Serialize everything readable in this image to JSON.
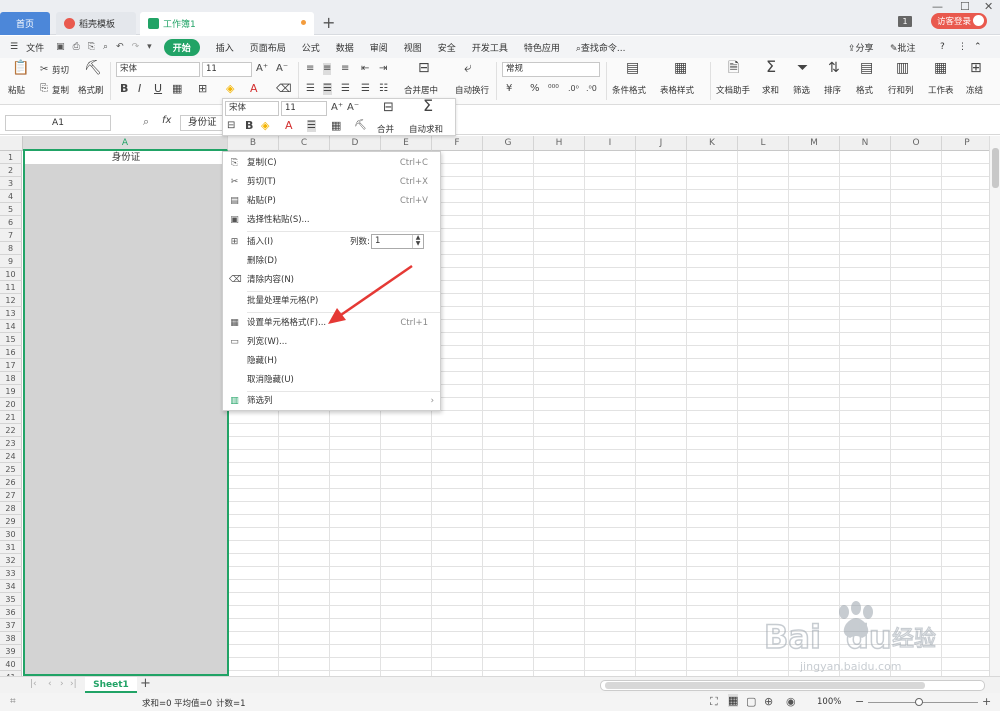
{
  "tabs": {
    "home": "首页",
    "template": "稻壳模板",
    "workbook": "工作簿1",
    "add": "+"
  },
  "topright": {
    "count_badge": "1",
    "guest_login": "访客登录"
  },
  "menu": {
    "file": "文件",
    "items": [
      "开始",
      "插入",
      "页面布局",
      "公式",
      "数据",
      "审阅",
      "视图",
      "安全",
      "开发工具",
      "特色应用"
    ],
    "search": "查找命令...",
    "share": "分享",
    "comment": "批注",
    "help": "?"
  },
  "ribbon": {
    "cut": "剪切",
    "paste": "粘贴",
    "copy": "复制",
    "format_painter": "格式刷",
    "font": "宋体",
    "size": "11",
    "merge_center": "合并居中",
    "wrap": "自动换行",
    "number_format": "常规",
    "cond_format": "条件格式",
    "table_style": "表格样式",
    "doc_helper": "文档助手",
    "sum": "求和",
    "filter": "筛选",
    "sort": "排序",
    "format": "格式",
    "rowcol": "行和列",
    "worksheet": "工作表",
    "freeze": "冻结"
  },
  "formula": {
    "namebox": "A1",
    "fx": "fx",
    "content": "身份证"
  },
  "mini_toolbar": {
    "font": "宋体",
    "size": "11",
    "merge": "合并",
    "autosum": "自动求和"
  },
  "grid": {
    "columns": [
      "A",
      "B",
      "C",
      "D",
      "E",
      "F",
      "G",
      "H",
      "I",
      "J",
      "K",
      "L",
      "M",
      "N",
      "O",
      "P"
    ],
    "rows": [
      "1",
      "2",
      "3",
      "4",
      "5",
      "6",
      "7",
      "8",
      "9",
      "10",
      "11",
      "12",
      "13",
      "14",
      "15",
      "16",
      "17",
      "18",
      "19",
      "20",
      "21",
      "22",
      "23",
      "24",
      "25",
      "26",
      "27",
      "28",
      "29",
      "30",
      "31",
      "32",
      "33",
      "34",
      "35",
      "36",
      "37",
      "38",
      "39",
      "40",
      "41"
    ],
    "a1": "身份证"
  },
  "context_menu": {
    "copy": "复制(C)",
    "copy_key": "Ctrl+C",
    "cut": "剪切(T)",
    "cut_key": "Ctrl+X",
    "paste": "粘贴(P)",
    "paste_key": "Ctrl+V",
    "paste_special": "选择性粘贴(S)...",
    "insert": "插入(I)",
    "col_count_label": "列数:",
    "col_count_value": "1",
    "delete": "删除(D)",
    "clear": "清除内容(N)",
    "batch": "批量处理单元格(P)",
    "format_cells": "设置单元格格式(F)...",
    "format_cells_key": "Ctrl+1",
    "col_width": "列宽(W)...",
    "hide": "隐藏(H)",
    "unhide": "取消隐藏(U)",
    "filter_col": "筛选列"
  },
  "sheets": {
    "sheet1": "Sheet1",
    "add": "+"
  },
  "status": {
    "sum": "求和=0",
    "avg": "平均值=0",
    "count": "计数=1",
    "zoom": "100%"
  },
  "watermark": {
    "brand": "Bai",
    "brand2": "du",
    "cn": "经验",
    "url": "jingyan.baidu.com"
  },
  "colors": {
    "accent": "#21a366",
    "home_tab": "#4c87d9",
    "login": "#e9594e",
    "arrow": "#e53935"
  }
}
